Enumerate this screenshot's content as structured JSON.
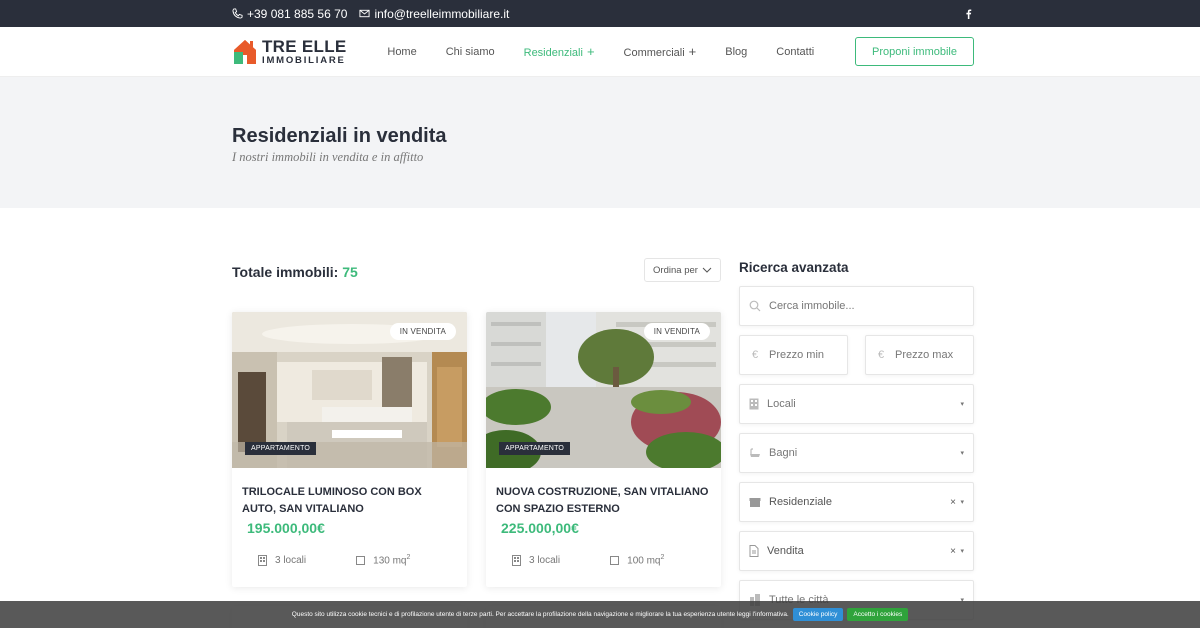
{
  "topbar": {
    "phone": "+39 081 885 56 70",
    "email": "info@treelleimmobiliare.it",
    "icons": [
      "phone-icon",
      "mail-icon",
      "facebook-icon"
    ]
  },
  "brand": {
    "line1": "TRE ELLE",
    "line2": "IMMOBILIARE",
    "colors": {
      "orange": "#e85a2a",
      "green": "#3dba7b"
    }
  },
  "nav": {
    "items": [
      {
        "label": "Home"
      },
      {
        "label": "Chi siamo"
      },
      {
        "label": "Residenziali",
        "plus": "+"
      },
      {
        "label": "Commerciali",
        "plus": "+"
      },
      {
        "label": "Blog"
      },
      {
        "label": "Contatti"
      }
    ],
    "cta": "Proponi immobile",
    "accent": "#3dba7b"
  },
  "hero": {
    "title": "Residenziali in vendita",
    "subtitle": "I nostri immobili in vendita e in affitto"
  },
  "listing": {
    "total_label": "Totale immobili:",
    "total_value": "75",
    "sort_label": "Ordina per",
    "cards": [
      {
        "status": "IN VENDITA",
        "type": "APPARTAMENTO",
        "title": "TRILOCALE LUMINOSO CON BOX AUTO, SAN VITALIANO",
        "price": "195.000,00€",
        "rooms": "3 locali",
        "area": "130 mq",
        "area_sup": "2"
      },
      {
        "status": "IN VENDITA",
        "type": "APPARTAMENTO",
        "title": "NUOVA COSTRUZIONE, SAN VITALIANO CON SPAZIO ESTERNO",
        "price": "225.000,00€",
        "rooms": "3 locali",
        "area": "100 mq",
        "area_sup": "2"
      }
    ]
  },
  "search": {
    "title": "Ricerca avanzata",
    "query_placeholder": "Cerca immobile...",
    "price_min_placeholder": "Prezzo min",
    "price_max_placeholder": "Prezzo max",
    "currency": "€",
    "locali": "Locali",
    "bagni": "Bagni",
    "category": "Residenziale",
    "contract": "Vendita",
    "city": "Tutte le città",
    "clear": "×",
    "caret": "▾"
  },
  "cookie": {
    "text": "Questo sito utilizza cookie tecnici e di profilazione utente di terze parti. Per accettare la profilazione della navigazione e migliorare la tua esperienza utente leggi l'informativa.",
    "policy": "Cookie policy",
    "accept": "Accetto i cookies"
  }
}
